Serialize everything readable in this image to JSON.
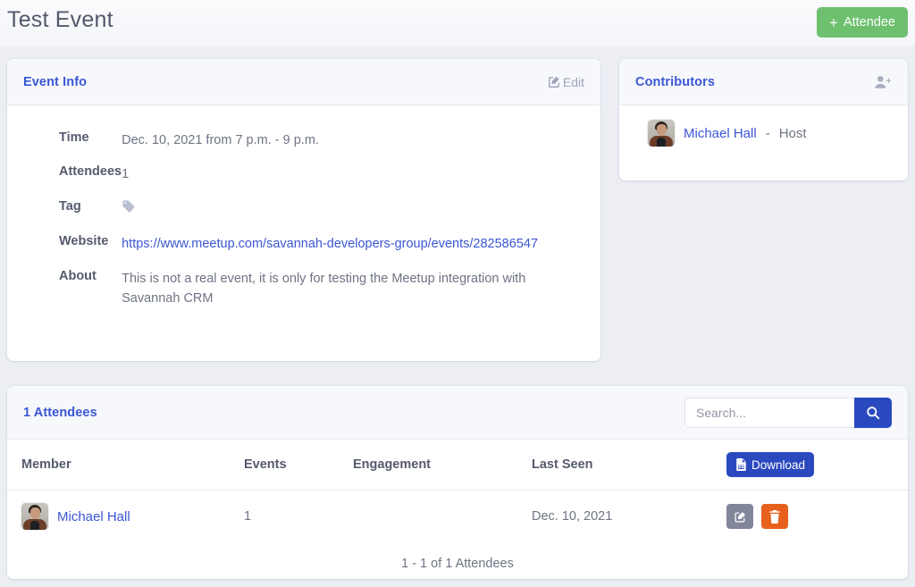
{
  "header": {
    "title": "Test Event",
    "add_attendee_label": "Attendee",
    "add_plus": "+"
  },
  "event_info": {
    "card_title": "Event Info",
    "edit_label": "Edit",
    "edit_icon": "pencil-square-icon",
    "rows": [
      {
        "label": "Time",
        "value": "Dec. 10, 2021 from 7 p.m. - 9 p.m."
      },
      {
        "label": "Attendees",
        "value": "1"
      },
      {
        "label": "Tag",
        "value": "",
        "icon": "tag-icon"
      },
      {
        "label": "Website",
        "value": "https://www.meetup.com/savannah-developers-group/events/282586547",
        "is_link": true
      },
      {
        "label": "About",
        "value": "This is not a real event, it is only for testing the Meetup integration with Savannah CRM"
      }
    ]
  },
  "contributors": {
    "card_title": "Contributors",
    "add_icon": "user-plus-icon",
    "people": [
      {
        "name": "Michael Hall",
        "separator": "-",
        "role": "Host",
        "avatar": "member-photo-avatar"
      }
    ]
  },
  "attendees": {
    "card_title": "1 Attendees",
    "search": {
      "placeholder": "Search...",
      "value": "",
      "icon": "search-icon"
    },
    "download_label": "Download",
    "download_icon": "file-spreadsheet-icon",
    "columns": [
      "Member",
      "Events",
      "Engagement",
      "Last Seen",
      ""
    ],
    "rows": [
      {
        "member": "Michael Hall",
        "avatar": "member-photo-avatar",
        "events": "1",
        "engagement": "",
        "last_seen": "Dec. 10, 2021",
        "actions": {
          "edit_icon": "pencil-square-icon",
          "delete_icon": "trash-icon"
        }
      }
    ],
    "pagination": "1 - 1 of 1 Attendees"
  },
  "colors": {
    "accent_blue": "#3b56d4",
    "button_blue": "#2b49bf",
    "green": "#6ec06e",
    "orange": "#e8611c",
    "gray": "#82869a",
    "page_bg": "#eceef4"
  }
}
